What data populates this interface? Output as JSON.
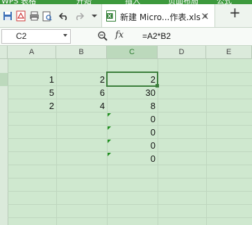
{
  "app": {
    "name_partial": "WPS 表格",
    "menu_partial": [
      "开始",
      "插入",
      "页面布局",
      "公式"
    ]
  },
  "toolbar": {
    "icons": [
      "save-icon",
      "pdf-icon",
      "print-icon",
      "preview-icon",
      "undo-icon",
      "redo-icon",
      "dropdown-icon"
    ]
  },
  "document_tab": {
    "title": "新建 Micro...作表.xls *",
    "close": "×",
    "new_tab": "+"
  },
  "formula_bar": {
    "name_box": "C2",
    "fx": "fx",
    "formula": "=A2*B2"
  },
  "columns": [
    "A",
    "B",
    "C",
    "D",
    "E"
  ],
  "cells": {
    "row2": {
      "A": "1",
      "B": "2",
      "C": "2"
    },
    "row3": {
      "A": "5",
      "B": "6",
      "C": "30"
    },
    "row4": {
      "A": "2",
      "B": "4",
      "C": "8"
    },
    "row5": {
      "C": "0"
    },
    "row6": {
      "C": "0"
    },
    "row7": {
      "C": "0"
    },
    "row8": {
      "C": "0"
    }
  },
  "colors": {
    "sheet_background": "#cfe8cf",
    "selection_border": "#3a7d3a",
    "error_indicator": "#1f8f1f"
  }
}
